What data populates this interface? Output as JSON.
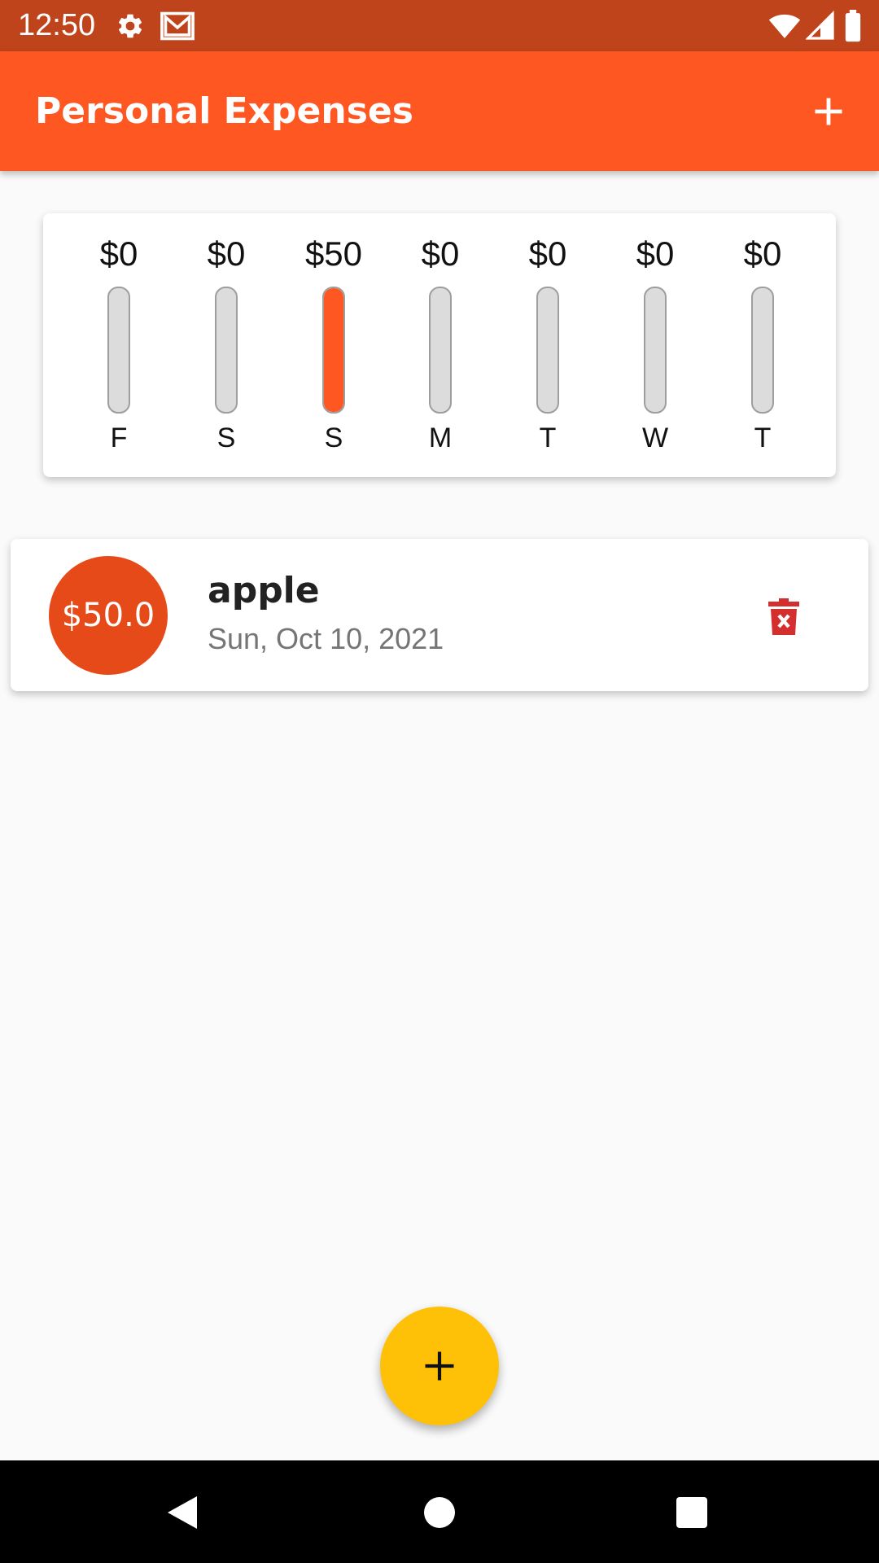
{
  "status_bar": {
    "time": "12:50",
    "icons": [
      "settings-icon",
      "gmail-icon",
      "wifi-icon",
      "signal-icon",
      "battery-icon"
    ]
  },
  "app_bar": {
    "title": "Personal Expenses",
    "add_icon": "plus-icon"
  },
  "chart": {
    "bars": [
      {
        "amount": "$0",
        "day": "F",
        "fill": 0
      },
      {
        "amount": "$0",
        "day": "S",
        "fill": 0
      },
      {
        "amount": "$50",
        "day": "S",
        "fill": 1.0
      },
      {
        "amount": "$0",
        "day": "M",
        "fill": 0
      },
      {
        "amount": "$0",
        "day": "T",
        "fill": 0
      },
      {
        "amount": "$0",
        "day": "W",
        "fill": 0
      },
      {
        "amount": "$0",
        "day": "T",
        "fill": 0
      }
    ]
  },
  "transactions": [
    {
      "amount": "$50.0",
      "title": "apple",
      "date": "Sun, Oct 10, 2021",
      "delete_icon": "trash-icon"
    }
  ],
  "fab": {
    "icon": "plus-icon"
  },
  "nav_bar": {
    "icons": [
      "back-icon",
      "home-icon",
      "recents-icon"
    ]
  },
  "colors": {
    "primary": "#fe5722",
    "primary_dark": "#bf441b",
    "avatar": "#e64a19",
    "accent": "#fec107",
    "delete": "#d32f2f"
  }
}
